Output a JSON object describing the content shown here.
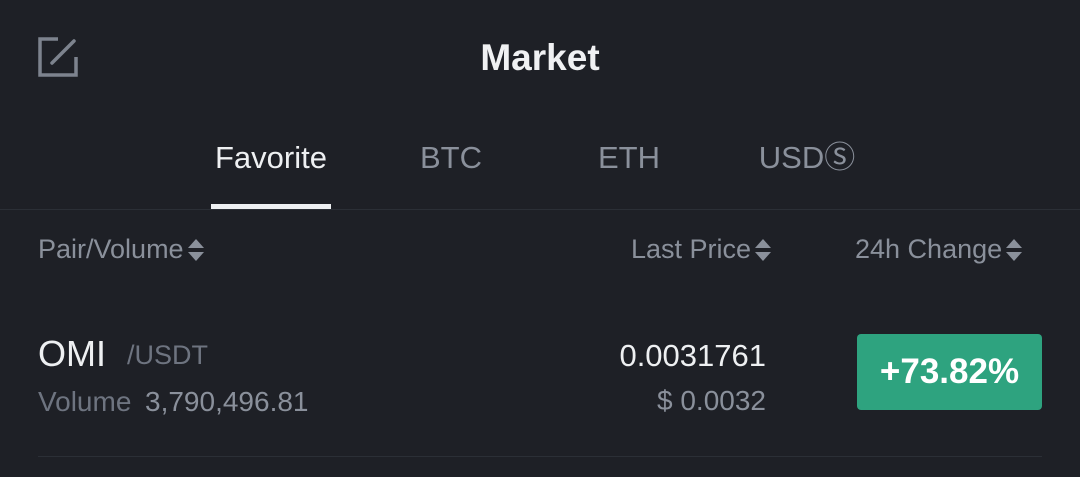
{
  "header": {
    "title": "Market",
    "edit_icon": "edit-icon"
  },
  "tabs": [
    {
      "label": "Favorite",
      "active": true
    },
    {
      "label": "BTC",
      "active": false
    },
    {
      "label": "ETH",
      "active": false
    },
    {
      "label": "USDⓈ",
      "active": false
    }
  ],
  "columns": {
    "pair": "Pair/Volume",
    "last_price": "Last Price",
    "change": "24h Change",
    "sort_icon": "sort-icon"
  },
  "rows": [
    {
      "base": "OMI",
      "quote": "/USDT",
      "volume_label": "Volume",
      "volume": "3,790,496.81",
      "last_price": "0.0031761",
      "fiat_price": "$ 0.0032",
      "change": "+73.82%"
    }
  ],
  "colors": {
    "background": "#1e2026",
    "positive": "#2ea37f",
    "text_primary": "#eef0f2",
    "text_secondary": "#8a909b"
  }
}
